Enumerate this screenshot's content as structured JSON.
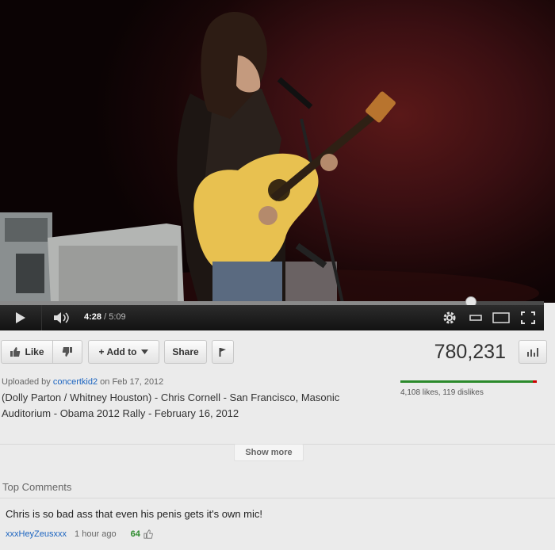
{
  "player": {
    "current_time": "4:28",
    "duration": "/ 5:09",
    "progress_fraction": 0.866
  },
  "actions": {
    "like_label": "Like",
    "add_to_label": "+ Add to",
    "share_label": "Share"
  },
  "stats": {
    "view_count": "780,231",
    "likes_summary": "4,108 likes, 119 dislikes",
    "likes": 4108,
    "dislikes": 119
  },
  "uploader": {
    "prefix": "Uploaded by",
    "name": "concertkid2",
    "date": "on Feb 17, 2012"
  },
  "description": "(Dolly Parton / Whitney Houston) - Chris Cornell - San Francisco, Masonic Auditorium - Obama 2012 Rally - February 16, 2012",
  "show_more_label": "Show more",
  "comments": {
    "section_title": "Top Comments",
    "items": [
      {
        "text": "Chris is so bad ass that even his penis gets it's own mic!",
        "author": "xxxHeyZeusxxx",
        "time": "1 hour ago",
        "score": "64"
      }
    ]
  },
  "colors": {
    "link": "#1b64c0",
    "like_green": "#2b8a2b",
    "dislike_red": "#cc0000"
  },
  "icons": [
    "play-icon",
    "volume-icon",
    "gear-icon",
    "small-player-icon",
    "large-player-icon",
    "fullscreen-icon",
    "thumbs-up-icon",
    "thumbs-down-icon",
    "dropdown-arrow-icon",
    "flag-icon",
    "stats-bars-icon"
  ]
}
